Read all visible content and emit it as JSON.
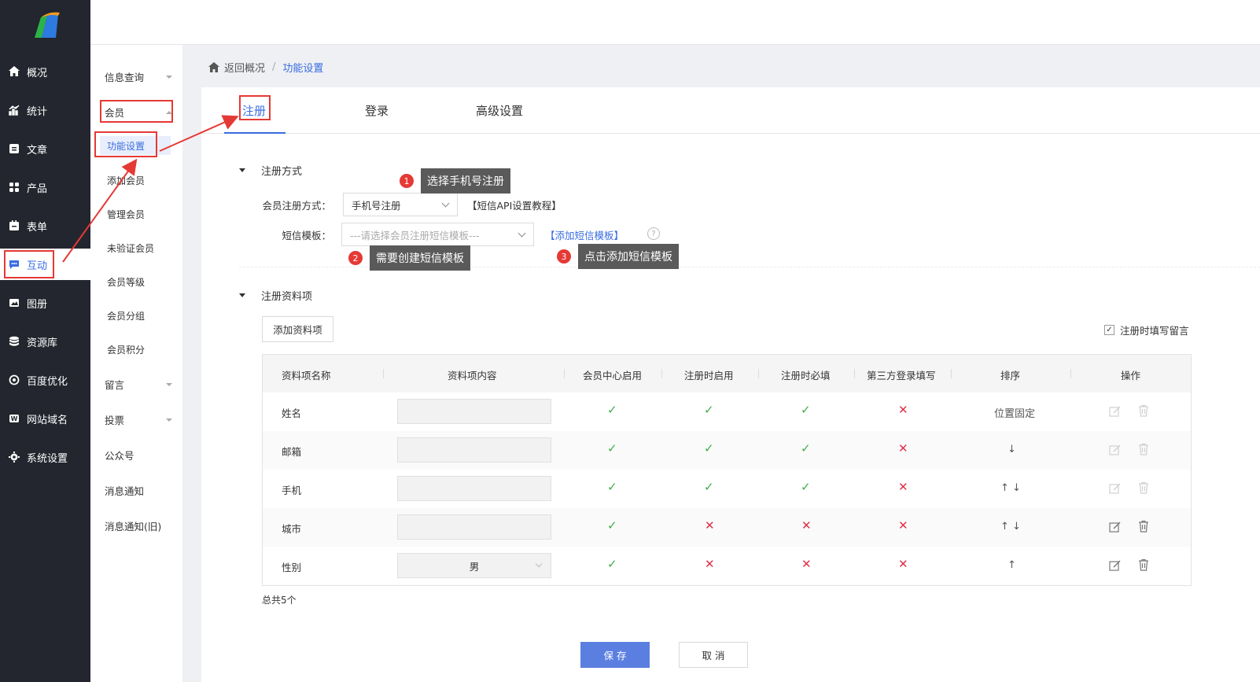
{
  "sidebar": {
    "items": [
      {
        "label": "概况",
        "icon": "home-icon"
      },
      {
        "label": "统计",
        "icon": "stats-icon"
      },
      {
        "label": "文章",
        "icon": "article-icon"
      },
      {
        "label": "产品",
        "icon": "product-icon"
      },
      {
        "label": "表单",
        "icon": "form-icon"
      },
      {
        "label": "互动",
        "icon": "chat-icon"
      },
      {
        "label": "图册",
        "icon": "album-icon"
      },
      {
        "label": "资源库",
        "icon": "database-icon"
      },
      {
        "label": "百度优化",
        "icon": "seo-icon"
      },
      {
        "label": "网站域名",
        "icon": "domain-icon"
      },
      {
        "label": "系统设置",
        "icon": "gear-icon"
      }
    ],
    "active_index": 5
  },
  "submenu": {
    "info_query": "信息查询",
    "member": "会员",
    "member_children": [
      "功能设置",
      "添加会员",
      "管理会员",
      "未验证会员",
      "会员等级",
      "会员分组",
      "会员积分"
    ],
    "message": "留言",
    "vote": "投票",
    "official_account": "公众号",
    "notify": "消息通知",
    "notify_old": "消息通知(旧)"
  },
  "breadcrumb": {
    "back": "返回概况",
    "sep": "/",
    "current": "功能设置"
  },
  "tabs": [
    "注册",
    "登录",
    "高级设置"
  ],
  "section1": {
    "title": "注册方式",
    "method_label": "会员注册方式：",
    "method_value": "手机号注册",
    "api_tutorial": "【短信API设置教程】",
    "template_label": "短信模板：",
    "template_placeholder": "---请选择会员注册短信模板---",
    "add_template": "【添加短信模板】",
    "help": "?"
  },
  "callouts": [
    {
      "num": "1",
      "text": "选择手机号注册"
    },
    {
      "num": "2",
      "text": "需要创建短信模板"
    },
    {
      "num": "3",
      "text": "点击添加短信模板"
    }
  ],
  "section2": {
    "title": "注册资料项",
    "add_button": "添加资料项",
    "leave_msg": "注册时填写留言",
    "leave_msg_checked": true
  },
  "table": {
    "headers": [
      "资料项名称",
      "资料项内容",
      "会员中心启用",
      "注册时启用",
      "注册时必填",
      "第三方登录填写",
      "排序",
      "操作"
    ],
    "rows": [
      {
        "name": "姓名",
        "content": "",
        "member_center": true,
        "reg_enable": true,
        "reg_required": true,
        "third_party": false,
        "sort": "位置固定",
        "actions_enabled": false
      },
      {
        "name": "邮箱",
        "content": "",
        "member_center": true,
        "reg_enable": true,
        "reg_required": true,
        "third_party": false,
        "sort": "↓",
        "actions_enabled": false
      },
      {
        "name": "手机",
        "content": "",
        "member_center": true,
        "reg_enable": true,
        "reg_required": true,
        "third_party": false,
        "sort": "↑ ↓",
        "actions_enabled": false
      },
      {
        "name": "城市",
        "content": "",
        "member_center": true,
        "reg_enable": false,
        "reg_required": false,
        "third_party": false,
        "sort": "↑ ↓",
        "actions_enabled": true
      },
      {
        "name": "性别",
        "content": "男",
        "member_center": true,
        "reg_enable": false,
        "reg_required": false,
        "third_party": false,
        "sort": "↑",
        "actions_enabled": true
      }
    ],
    "total": "总共5个"
  },
  "footer": {
    "save": "保 存",
    "cancel": "取 消"
  },
  "colors": {
    "accent": "#3a6de0",
    "annotation": "#e53935",
    "check": "#3fae49",
    "cross": "#e0304a",
    "sidebar": "#23262e"
  }
}
